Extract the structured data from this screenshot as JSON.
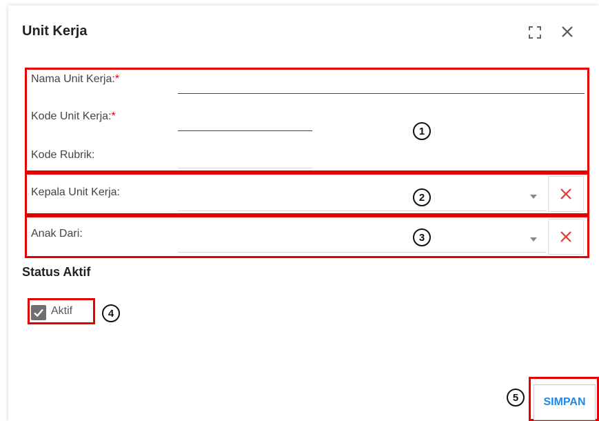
{
  "dialog": {
    "title": "Unit Kerja",
    "maximize_icon": "maximize-icon",
    "close_icon": "close-icon"
  },
  "form": {
    "nama_label": "Nama Unit Kerja:",
    "nama_required": "*",
    "nama_value": "",
    "kode_label": "Kode Unit Kerja:",
    "kode_required": "*",
    "kode_value": "",
    "rubrik_label": "Kode Rubrik:",
    "rubrik_value": "",
    "kepala_label": "Kepala Unit Kerja:",
    "kepala_value": "",
    "anak_label": "Anak Dari:",
    "anak_value": ""
  },
  "status": {
    "title": "Status Aktif",
    "aktif_label": "Aktif",
    "aktif_checked": true
  },
  "actions": {
    "save_label": "SIMPAN"
  },
  "annotations": [
    "1",
    "2",
    "3",
    "4",
    "5"
  ],
  "colors": {
    "annotation_red": "#e60000",
    "primary_blue": "#1e88e5",
    "checkbox_gray": "#6f6f6f"
  }
}
